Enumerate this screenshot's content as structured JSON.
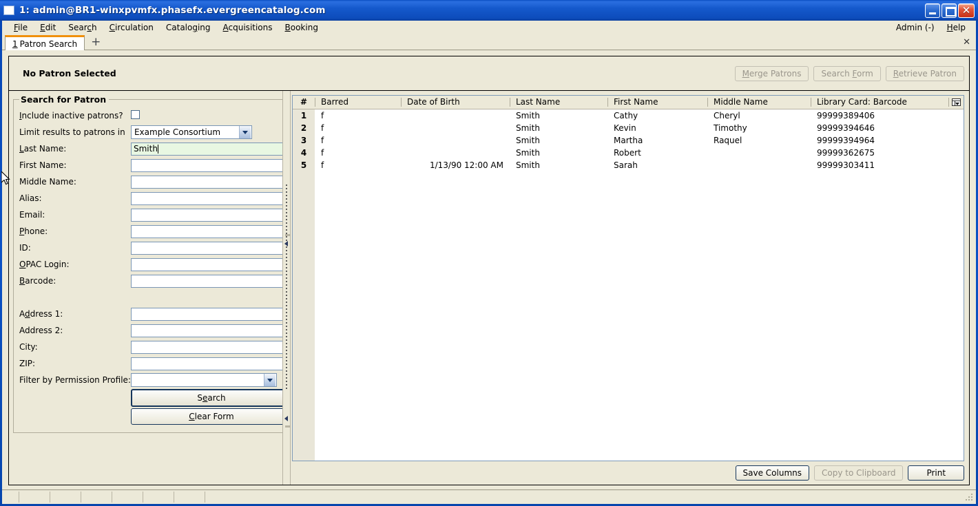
{
  "window": {
    "title": "1: admin@BR1-winxpvmfx.phasefx.evergreencatalog.com",
    "minimize_label": "Minimize",
    "maximize_label": "Maximize",
    "close_label": "✕"
  },
  "menubar": {
    "items": [
      {
        "label": "File",
        "accesskey": "F"
      },
      {
        "label": "Edit",
        "accesskey": "E"
      },
      {
        "label": "Search",
        "accesskey": "c"
      },
      {
        "label": "Circulation",
        "accesskey": "C"
      },
      {
        "label": "Cataloging",
        "accesskey": "g"
      },
      {
        "label": "Acquisitions",
        "accesskey": "A"
      },
      {
        "label": "Booking",
        "accesskey": "B"
      }
    ],
    "admin_label": "Admin (-)",
    "help_label": "Help"
  },
  "tabbar": {
    "tab_number": "1",
    "tab_title": "Patron Search",
    "new_tab_label": "+",
    "close_label": "✕"
  },
  "patron_header": {
    "title": "No Patron Selected",
    "buttons": [
      {
        "label": "Merge Patrons",
        "accesskey": "M",
        "disabled": true
      },
      {
        "label": "Search Form",
        "accesskey": "F",
        "disabled": true
      },
      {
        "label": "Retrieve Patron",
        "accesskey": "R",
        "disabled": true
      }
    ]
  },
  "search_form": {
    "legend": "Search for Patron",
    "include_inactive_label": "Include inactive patrons?",
    "include_inactive_checked": false,
    "limit_label": "Limit results to patrons in",
    "limit_value": "Example Consortium",
    "fields": [
      {
        "label": "Last Name:",
        "value": "Smith",
        "focused": true
      },
      {
        "label": "First Name:",
        "value": ""
      },
      {
        "label": "Middle Name:",
        "value": ""
      },
      {
        "label": "Alias:",
        "value": ""
      },
      {
        "label": "Email:",
        "value": ""
      },
      {
        "label": "Phone:",
        "value": ""
      },
      {
        "label": "ID:",
        "value": ""
      },
      {
        "label": "OPAC Login:",
        "value": ""
      },
      {
        "label": "Barcode:",
        "value": ""
      }
    ],
    "address_fields": [
      {
        "label": "Address 1:",
        "value": ""
      },
      {
        "label": "Address 2:",
        "value": ""
      },
      {
        "label": "City:",
        "value": ""
      },
      {
        "label": "ZIP:",
        "value": ""
      }
    ],
    "permission_profile_label": "Filter by Permission Profile:",
    "permission_profile_value": "",
    "search_button": "Search",
    "clear_button": "Clear Form"
  },
  "results": {
    "columns": [
      "#",
      "Barred",
      "Date of Birth",
      "Last Name",
      "First Name",
      "Middle Name",
      "Library Card: Barcode"
    ],
    "rows": [
      {
        "num": "1",
        "barred": "f",
        "dob": "",
        "last": "Smith",
        "first": "Cathy",
        "middle": "Cheryl",
        "barcode": "99999389406"
      },
      {
        "num": "2",
        "barred": "f",
        "dob": "",
        "last": "Smith",
        "first": "Kevin",
        "middle": "Timothy",
        "barcode": "99999394646"
      },
      {
        "num": "3",
        "barred": "f",
        "dob": "",
        "last": "Smith",
        "first": "Martha",
        "middle": "Raquel",
        "barcode": "99999394964"
      },
      {
        "num": "4",
        "barred": "f",
        "dob": "",
        "last": "Smith",
        "first": "Robert",
        "middle": "",
        "barcode": "99999362675"
      },
      {
        "num": "5",
        "barred": "f",
        "dob": "1/13/90 12:00 AM",
        "last": "Smith",
        "first": "Sarah",
        "middle": "",
        "barcode": "99999303411"
      }
    ],
    "footer_buttons": [
      {
        "label": "Save Columns",
        "disabled": false
      },
      {
        "label": "Copy to Clipboard",
        "disabled": true
      },
      {
        "label": "Print",
        "disabled": false
      }
    ]
  },
  "colors": {
    "titlebar_blue": "#0a51c6",
    "chrome_beige": "#ece9d8",
    "tab_accent": "#f0900b",
    "focused_field_green": "#e6f7e0",
    "grid_gutter": "#e9e6d8"
  }
}
